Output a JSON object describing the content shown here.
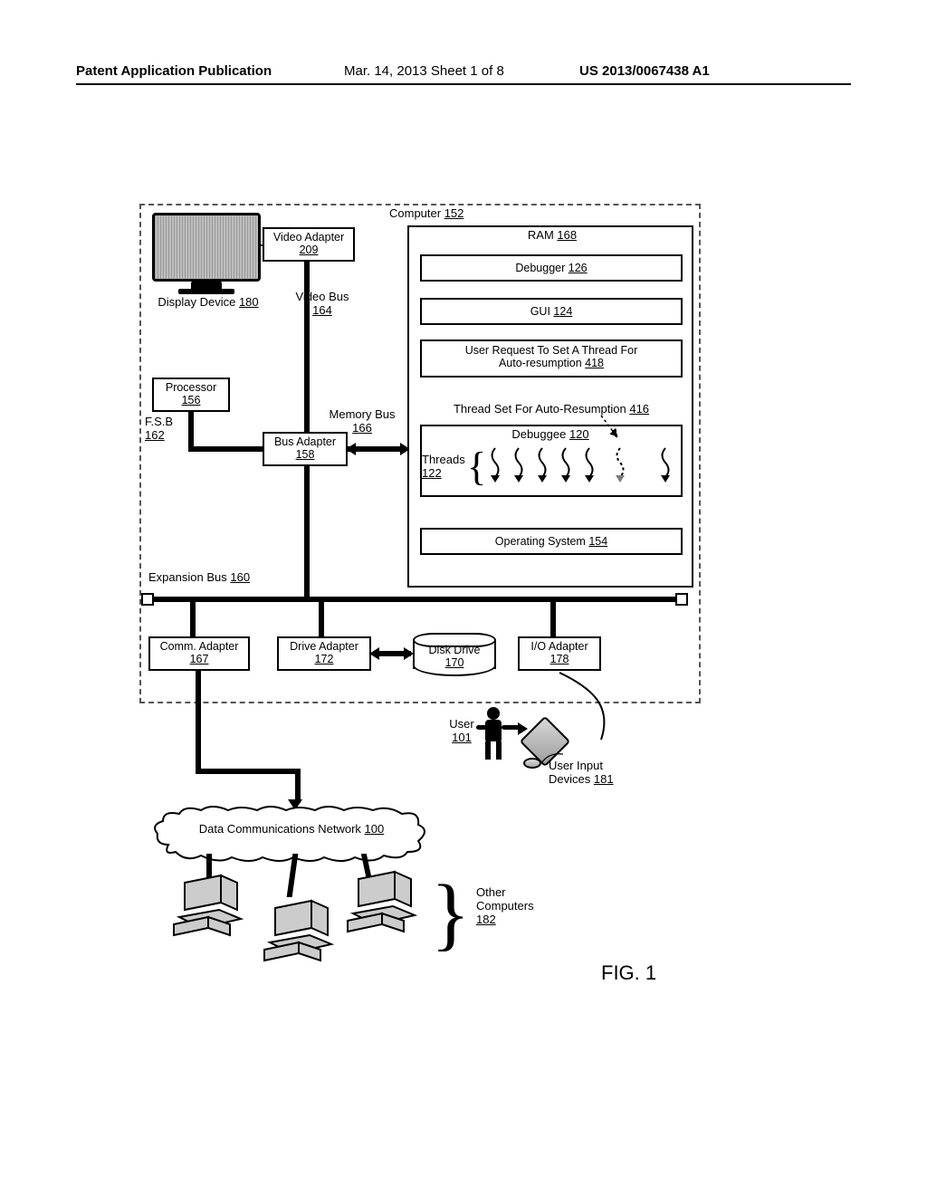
{
  "header": {
    "left": "Patent Application Publication",
    "mid": "Mar. 14, 2013  Sheet 1 of 8",
    "right": "US 2013/0067438 A1"
  },
  "figure": {
    "label": "FIG. 1"
  },
  "computer": {
    "title": "Computer",
    "num": "152"
  },
  "display_device": {
    "title": "Display Device",
    "num": "180"
  },
  "video_adapter": {
    "title": "Video Adapter",
    "num": "209"
  },
  "video_bus": {
    "title": "Video Bus",
    "num": "164"
  },
  "processor": {
    "title": "Processor",
    "num": "156"
  },
  "fsb": {
    "title": "F.S.B",
    "num": "162"
  },
  "bus_adapter": {
    "title": "Bus Adapter",
    "num": "158"
  },
  "memory_bus": {
    "title": "Memory Bus",
    "num": "166"
  },
  "expansion_bus": {
    "title": "Expansion Bus",
    "num": "160"
  },
  "comm_adapter": {
    "title": "Comm. Adapter",
    "num": "167"
  },
  "drive_adapter": {
    "title": "Drive Adapter",
    "num": "172"
  },
  "disk_drive": {
    "title": "Disk Drive",
    "num": "170"
  },
  "io_adapter": {
    "title": "I/O Adapter",
    "num": "178"
  },
  "ram": {
    "title": "RAM",
    "num": "168"
  },
  "debugger": {
    "title": "Debugger",
    "num": "126"
  },
  "gui": {
    "title": "GUI",
    "num": "124"
  },
  "user_request": {
    "title": "User Request To Set A Thread For Auto-resumption",
    "num": "418"
  },
  "thread_set": {
    "title": "Thread Set For Auto-Resumption",
    "num": "416"
  },
  "debuggee": {
    "title": "Debuggee",
    "num": "120"
  },
  "threads": {
    "title": "Threads",
    "num": "122"
  },
  "os": {
    "title": "Operating System",
    "num": "154"
  },
  "user": {
    "title": "User",
    "num": "101"
  },
  "user_input_devices": {
    "title": "User Input Devices",
    "num": "181"
  },
  "network": {
    "title": "Data Communications Network",
    "num": "100"
  },
  "other_computers": {
    "title": "Other Computers",
    "num": "182"
  }
}
